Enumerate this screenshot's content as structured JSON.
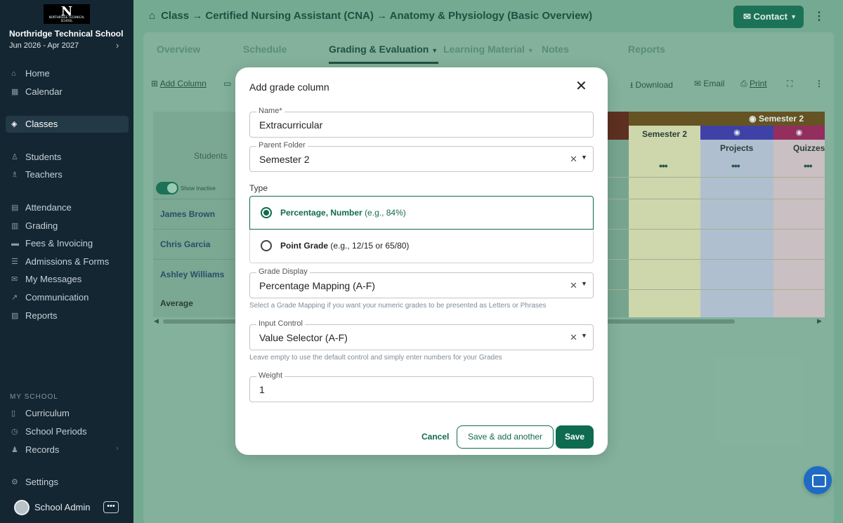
{
  "sidebar": {
    "logo_text": "N",
    "logo_caption": "NORTHRIDGE TECHNICAL SCHOOL",
    "school_name": "Northridge Technical School",
    "term": "Jun 2026 - Apr 2027",
    "items": [
      {
        "label": "Home",
        "icon": "home-icon"
      },
      {
        "label": "Calendar",
        "icon": "calendar-icon"
      },
      {
        "label": "Classes",
        "icon": "graduation-cap-icon",
        "active": true
      },
      {
        "label": "Students",
        "icon": "user-icon"
      },
      {
        "label": "Teachers",
        "icon": "teacher-icon"
      },
      {
        "label": "Attendance",
        "icon": "attendance-icon"
      },
      {
        "label": "Grading",
        "icon": "grading-icon"
      },
      {
        "label": "Fees & Invoicing",
        "icon": "invoice-icon"
      },
      {
        "label": "Admissions & Forms",
        "icon": "forms-icon"
      },
      {
        "label": "My Messages",
        "icon": "mail-icon"
      },
      {
        "label": "Communication",
        "icon": "send-icon"
      },
      {
        "label": "Reports",
        "icon": "report-icon"
      }
    ],
    "section_label": "MY SCHOOL",
    "school_items": [
      {
        "label": "Curriculum",
        "icon": "book-icon"
      },
      {
        "label": "School Periods",
        "icon": "clock-icon"
      },
      {
        "label": "Records",
        "icon": "records-icon"
      }
    ],
    "settings_label": "Settings",
    "user_name": "School Admin"
  },
  "header": {
    "breadcrumb": "Class → Certified Nursing Assistant (CNA) → Anatomy & Physiology (Basic Overview)",
    "contact_label": "Contact"
  },
  "tabs": [
    "Overview",
    "Schedule",
    "Grading & Evaluation",
    "Learning Material",
    "Notes",
    "Reports"
  ],
  "toolbar": {
    "add_column": "Add Column",
    "download": "Download",
    "email": "Email",
    "print": "Print"
  },
  "grid": {
    "students_label": "Students",
    "show_inactive": "Show Inactive",
    "students": [
      "James Brown",
      "Chris Garcia",
      "Ashley Williams"
    ],
    "average_label": "Average",
    "semester_group": "Semester 2",
    "columns": [
      "Semester 2",
      "Projects",
      "Quizzes"
    ],
    "colors": {
      "semester": "#6a4511",
      "projects": "#3b2fb0",
      "quizzes": "#a0185a"
    }
  },
  "modal": {
    "title": "Add grade column",
    "name_label": "Name*",
    "name_value": "Extracurricular",
    "parent_label": "Parent Folder",
    "parent_value": "Semester 2",
    "type_label": "Type",
    "type_options": [
      {
        "title": "Percentage, Number",
        "example": "(e.g., 84%)",
        "selected": true
      },
      {
        "title": "Point Grade",
        "example": "(e.g., 12/15 or 65/80)",
        "selected": false
      }
    ],
    "display_label": "Grade Display",
    "display_value": "Percentage Mapping (A-F)",
    "display_hint": "Select a Grade Mapping if you want your numeric grades to be presented as Letters or Phrases",
    "input_label": "Input Control",
    "input_value": "Value Selector (A-F)",
    "input_hint": "Leave empty to use the default control and simply enter numbers for your Grades",
    "weight_label": "Weight",
    "weight_value": "1",
    "cancel": "Cancel",
    "save_another": "Save & add another",
    "save": "Save"
  },
  "accent_color": "#0f6b4f"
}
